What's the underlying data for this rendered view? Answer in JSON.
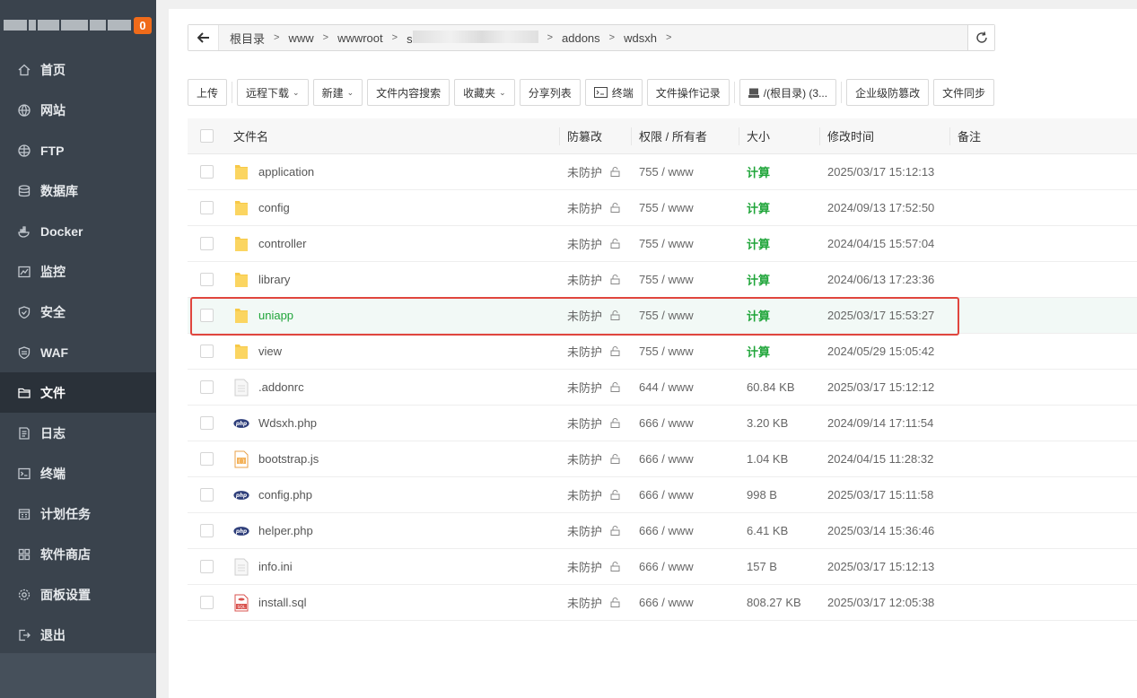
{
  "sidebar": {
    "badge": "0",
    "items": [
      {
        "label": "首页",
        "icon": "home-icon"
      },
      {
        "label": "网站",
        "icon": "globe-icon"
      },
      {
        "label": "FTP",
        "icon": "ftp-globe-icon"
      },
      {
        "label": "数据库",
        "icon": "database-icon"
      },
      {
        "label": "Docker",
        "icon": "docker-icon"
      },
      {
        "label": "监控",
        "icon": "monitor-icon"
      },
      {
        "label": "安全",
        "icon": "shield-icon"
      },
      {
        "label": "WAF",
        "icon": "waf-shield-icon"
      },
      {
        "label": "文件",
        "icon": "folder-icon",
        "active": true
      },
      {
        "label": "日志",
        "icon": "log-icon"
      },
      {
        "label": "终端",
        "icon": "terminal-icon"
      },
      {
        "label": "计划任务",
        "icon": "calendar-icon"
      },
      {
        "label": "软件商店",
        "icon": "apps-icon"
      },
      {
        "label": "面板设置",
        "icon": "settings-icon"
      },
      {
        "label": "退出",
        "icon": "logout-icon"
      }
    ]
  },
  "path": {
    "crumbs": [
      "根目录",
      "www",
      "wwwroot",
      "s",
      "addons",
      "wdsxh"
    ]
  },
  "toolbar": {
    "upload": "上传",
    "remote_download": "远程下载",
    "new": "新建",
    "content_search": "文件内容搜索",
    "favorites": "收藏夹",
    "share_list": "分享列表",
    "terminal": "终端",
    "op_log": "文件操作记录",
    "disk": "/(根目录) (3...",
    "tamper": "企业级防篡改",
    "sync": "文件同步"
  },
  "table": {
    "headers": {
      "name": "文件名",
      "tamper": "防篡改",
      "perm": "权限 / 所有者",
      "size": "大小",
      "mtime": "修改时间",
      "note": "备注"
    },
    "rows": [
      {
        "name": "application",
        "type": "folder",
        "tamper": "未防护",
        "perm": "755 / www",
        "size": "计算",
        "mtime": "2025/03/17 15:12:13"
      },
      {
        "name": "config",
        "type": "folder",
        "tamper": "未防护",
        "perm": "755 / www",
        "size": "计算",
        "mtime": "2024/09/13 17:52:50"
      },
      {
        "name": "controller",
        "type": "folder",
        "tamper": "未防护",
        "perm": "755 / www",
        "size": "计算",
        "mtime": "2024/04/15 15:57:04"
      },
      {
        "name": "library",
        "type": "folder",
        "tamper": "未防护",
        "perm": "755 / www",
        "size": "计算",
        "mtime": "2024/06/13 17:23:36"
      },
      {
        "name": "uniapp",
        "type": "folder",
        "tamper": "未防护",
        "perm": "755 / www",
        "size": "计算",
        "mtime": "2025/03/17 15:53:27",
        "selected": true
      },
      {
        "name": "view",
        "type": "folder",
        "tamper": "未防护",
        "perm": "755 / www",
        "size": "计算",
        "mtime": "2024/05/29 15:05:42"
      },
      {
        "name": ".addonrc",
        "type": "text",
        "tamper": "未防护",
        "perm": "644 / www",
        "size": "60.84 KB",
        "mtime": "2025/03/17 15:12:12"
      },
      {
        "name": "Wdsxh.php",
        "type": "php",
        "tamper": "未防护",
        "perm": "666 / www",
        "size": "3.20 KB",
        "mtime": "2024/09/14 17:11:54"
      },
      {
        "name": "bootstrap.js",
        "type": "js",
        "tamper": "未防护",
        "perm": "666 / www",
        "size": "1.04 KB",
        "mtime": "2024/04/15 11:28:32"
      },
      {
        "name": "config.php",
        "type": "php",
        "tamper": "未防护",
        "perm": "666 / www",
        "size": "998 B",
        "mtime": "2025/03/17 15:11:58"
      },
      {
        "name": "helper.php",
        "type": "php",
        "tamper": "未防护",
        "perm": "666 / www",
        "size": "6.41 KB",
        "mtime": "2025/03/14 15:36:46"
      },
      {
        "name": "info.ini",
        "type": "text",
        "tamper": "未防护",
        "perm": "666 / www",
        "size": "157 B",
        "mtime": "2025/03/17 15:12:13"
      },
      {
        "name": "install.sql",
        "type": "sql",
        "tamper": "未防护",
        "perm": "666 / www",
        "size": "808.27 KB",
        "mtime": "2025/03/17 12:05:38"
      }
    ]
  },
  "colors": {
    "sidebar_bg": "#3a434d",
    "accent_green": "#20a53a",
    "badge_orange": "#f06b1a",
    "highlight_red": "#e0463e"
  }
}
